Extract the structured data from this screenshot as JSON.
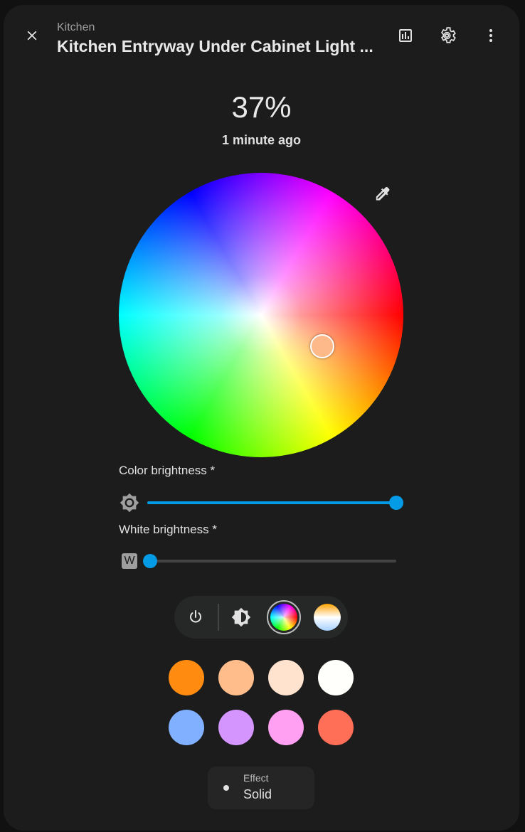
{
  "header": {
    "area": "Kitchen",
    "title": "Kitchen Entryway Under Cabinet Light ...",
    "icons": [
      "close-icon",
      "chart-box-icon",
      "cog-icon",
      "dots-vertical-icon"
    ]
  },
  "state": {
    "value": "37%",
    "last_changed": "1 minute ago"
  },
  "color_wheel": {
    "selected_color": "#fdb98a",
    "icon": "eyedropper-icon"
  },
  "color_brightness": {
    "label": "Color brightness *",
    "value_percent": 100,
    "accent": "#039be5"
  },
  "white_brightness": {
    "label": "White brightness *",
    "value_percent": 0,
    "icon_letter": "W"
  },
  "modes": [
    {
      "name": "power",
      "icon": "power-icon"
    },
    {
      "name": "brightness",
      "icon": "brightness-icon"
    },
    {
      "name": "color",
      "icon": "color-wheel-icon",
      "selected": true
    },
    {
      "name": "color-temp",
      "icon": "color-temp-icon"
    }
  ],
  "presets": [
    "#ff8b11",
    "#ffbd8b",
    "#ffe3cf",
    "#fffffb",
    "#80b0ff",
    "#d495ff",
    "#ffa0f2",
    "#ff6e57"
  ],
  "effect": {
    "label": "Effect",
    "value": "Solid"
  }
}
